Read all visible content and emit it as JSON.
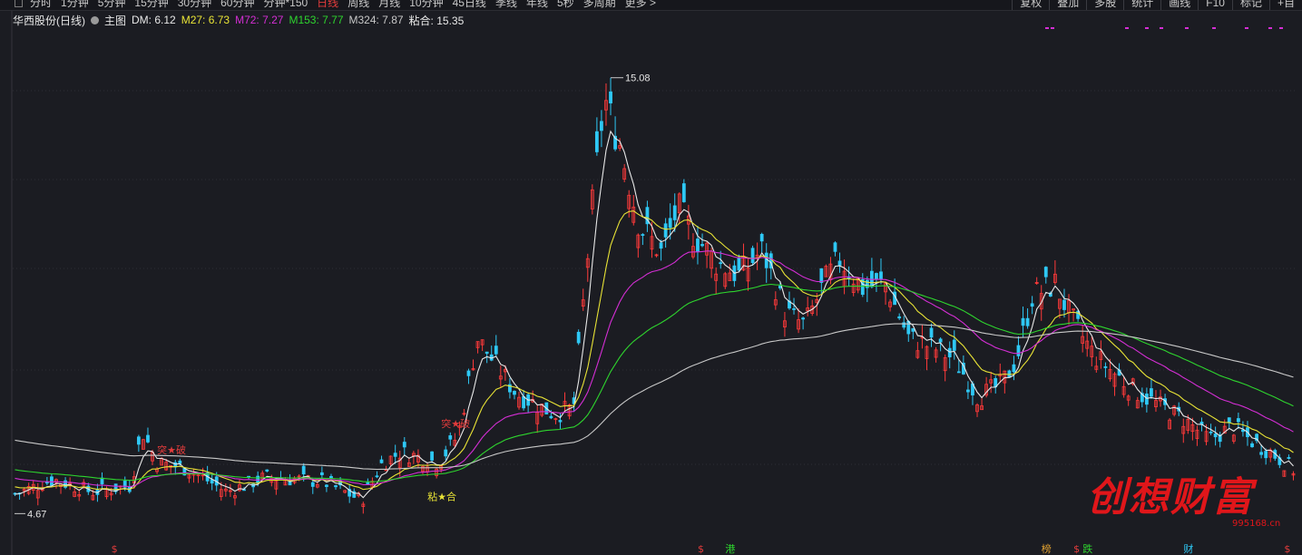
{
  "toolbar": {
    "periods": [
      {
        "label": "分时",
        "active": false
      },
      {
        "label": "1分钟",
        "active": false
      },
      {
        "label": "5分钟",
        "active": false
      },
      {
        "label": "15分钟",
        "active": false
      },
      {
        "label": "30分钟",
        "active": false
      },
      {
        "label": "60分钟",
        "active": false
      },
      {
        "label": "分钟*150",
        "active": false
      },
      {
        "label": "日线",
        "active": true
      },
      {
        "label": "周线",
        "active": false
      },
      {
        "label": "月线",
        "active": false
      },
      {
        "label": "10分钟",
        "active": false
      },
      {
        "label": "45日线",
        "active": false
      },
      {
        "label": "季线",
        "active": false
      },
      {
        "label": "年线",
        "active": false
      },
      {
        "label": "5秒",
        "active": false
      },
      {
        "label": "多周期",
        "active": false
      },
      {
        "label": "更多 >",
        "active": false
      }
    ],
    "right_tools": [
      "复权",
      "叠加",
      "多股",
      "统计",
      "画线",
      "F10",
      "标记",
      "+自"
    ]
  },
  "indicator_bar": {
    "stock_name": "华西股份(日线)",
    "main_label": "主图",
    "dm": "DM: 6.12",
    "m27": "M27: 6.73",
    "m72": "M72: 7.27",
    "m153": "M153: 7.77",
    "m324": "M324: 7.87",
    "stick": "粘合: 15.35"
  },
  "colors": {
    "up": "#ff3a3a",
    "down": "#2ec8f5",
    "dm": "#e8e8e8",
    "m27": "#e8e336",
    "m72": "#d42ed4",
    "m153": "#2ed42e",
    "m324": "#c8c8c8",
    "accent_red": "#e33c3c",
    "background": "#1b1c22"
  },
  "chart_data": {
    "type": "candlestick",
    "price_high_label": "15.08",
    "price_low_label": "4.67",
    "ylim": [
      4.2,
      16.0
    ],
    "candles_count": 280,
    "series": [
      {
        "name": "DM",
        "key": "dm"
      },
      {
        "name": "M27",
        "key": "m27"
      },
      {
        "name": "M72",
        "key": "m72"
      },
      {
        "name": "M153",
        "key": "m153"
      },
      {
        "name": "M324",
        "key": "m324"
      }
    ],
    "annotations": [
      {
        "text": "突★破",
        "index": 33
      },
      {
        "text": "突★破",
        "index": 95
      },
      {
        "text": "粘★合",
        "index": 92
      }
    ],
    "markers": [
      {
        "text": "$",
        "index": 22,
        "color": "#e33c3c"
      },
      {
        "text": "$",
        "index": 150,
        "color": "#e33c3c"
      },
      {
        "text": "港",
        "index": 156,
        "color": "#2ed42e"
      },
      {
        "text": "榜",
        "index": 225,
        "color": "#e0a030"
      },
      {
        "text": "$",
        "index": 232,
        "color": "#e33c3c"
      },
      {
        "text": "跌",
        "index": 234,
        "color": "#2ed42e"
      },
      {
        "text": "财",
        "index": 256,
        "color": "#2ec8f5"
      },
      {
        "text": "$",
        "index": 278,
        "color": "#e33c3c"
      }
    ]
  },
  "watermark": {
    "text": "创想财富",
    "url": "995168.cn"
  }
}
